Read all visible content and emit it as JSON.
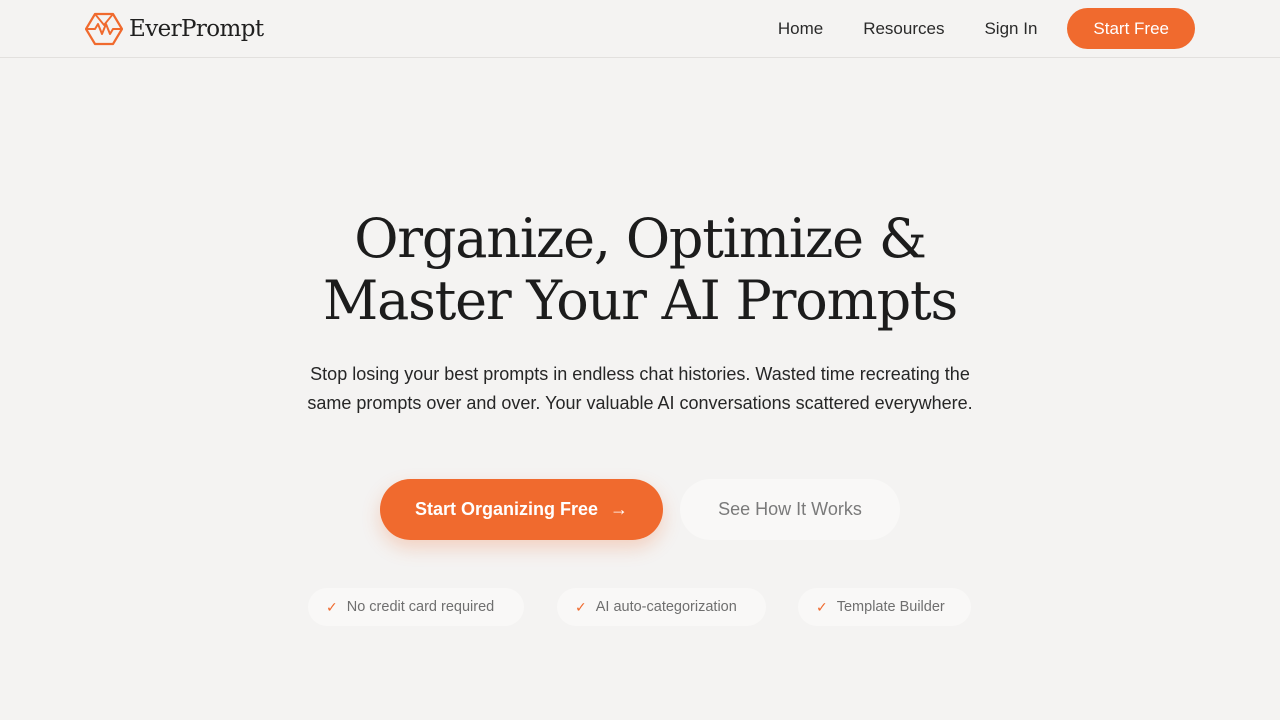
{
  "brand": {
    "name": "EverPrompt",
    "accent_color": "#f06a2e",
    "logo_icon": "hexagon-logo-icon"
  },
  "nav": {
    "links": [
      "Home",
      "Resources",
      "Sign In"
    ],
    "cta_label": "Start Free"
  },
  "hero": {
    "headline_line1": "Organize, Optimize &",
    "headline_line2": "Master Your AI Prompts",
    "subtext": "Stop losing your best prompts in endless chat histories. Wasted time recreating the same prompts over and over. Your valuable AI conversations scattered everywhere.",
    "primary_cta": "Start Organizing Free",
    "primary_cta_icon": "arrow-right-icon",
    "secondary_cta": "See How It Works",
    "badges": [
      "No credit card required",
      "AI auto-categorization",
      "Template Builder"
    ],
    "badge_icon": "check-icon"
  }
}
